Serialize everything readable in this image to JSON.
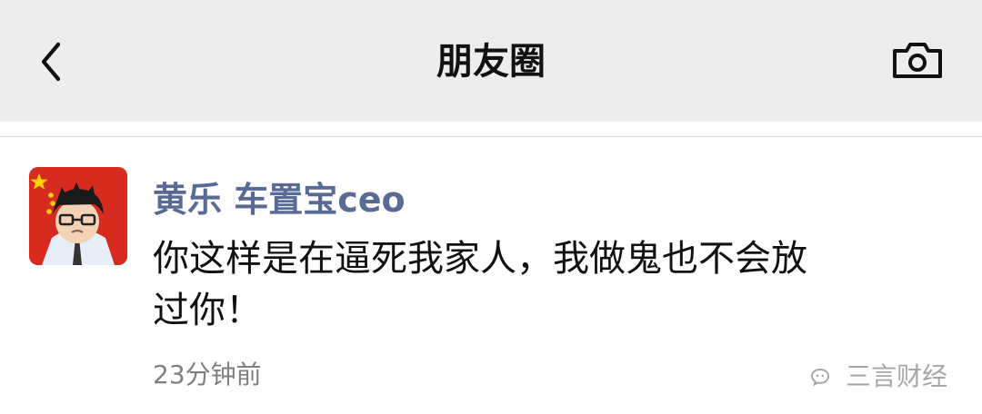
{
  "header": {
    "title": "朋友圈",
    "back_icon": "chevron-left-icon",
    "camera_icon": "camera-icon"
  },
  "post": {
    "username": "黄乐 车置宝ceo",
    "content_lines": [
      "你这样是在逼死我家人，我做鬼也不会放",
      "过你！"
    ],
    "timestamp": "23分钟前"
  },
  "watermark": {
    "label": "三言财经"
  },
  "colors": {
    "topbar_bg": "#ededed",
    "title_text": "#111111",
    "username": "#576b95",
    "body_text": "#111111",
    "timestamp": "#7f7f7f",
    "avatar_bg": "#d72b1f"
  }
}
